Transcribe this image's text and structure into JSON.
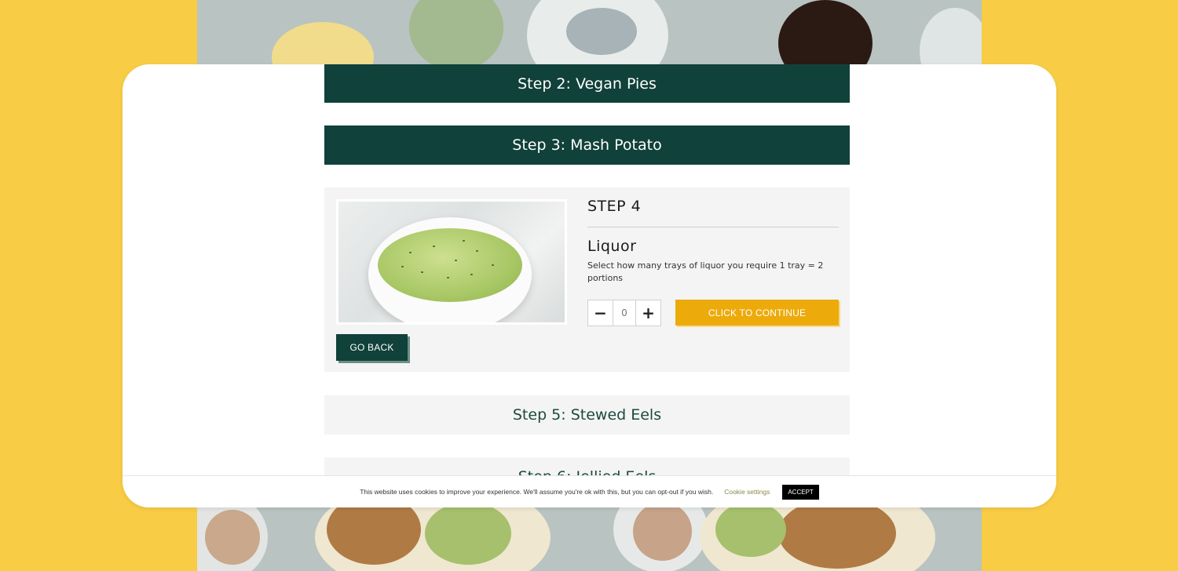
{
  "steps": {
    "step2": "Step 2: Vegan Pies",
    "step3": "Step 3: Mash Potato",
    "step5": "Step 5: Stewed Eels",
    "step6": "Step 6: Jellied Eels"
  },
  "current_step": {
    "label": "STEP 4",
    "title": "Liquor",
    "description": "Select how many trays of liquor you require 1 tray = 2 portions",
    "quantity": "0",
    "decrement_symbol": "−",
    "increment_symbol": "+",
    "continue_label": "CLICK TO CONTINUE",
    "back_label": "GO BACK",
    "image_icon": "liquor-bowl-photo"
  },
  "cookie_bar": {
    "text": "This website uses cookies to improve your experience. We'll assume you're ok with this, but you can opt-out if you wish.",
    "settings_label": "Cookie settings",
    "accept_label": "ACCEPT"
  },
  "colors": {
    "page_background": "#f8cc45",
    "dark_green": "#10413a",
    "accent_yellow": "#edaa0b",
    "panel_grey": "#f4f4f4"
  }
}
